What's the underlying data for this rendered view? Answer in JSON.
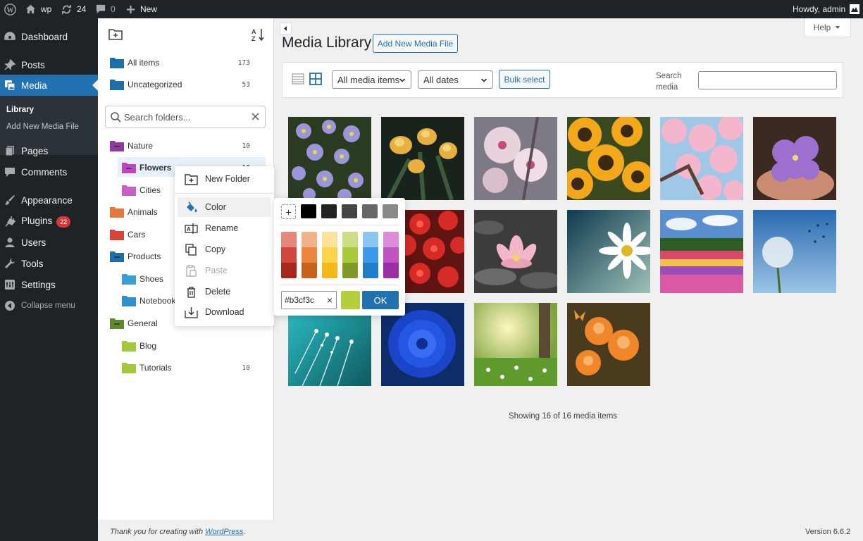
{
  "admin_bar": {
    "site_name": "wp",
    "updates_count": "24",
    "comments_count": "0",
    "new_label": "New",
    "greeting": "Howdy, admin"
  },
  "sidebar": {
    "items": [
      {
        "label": "Dashboard",
        "icon": "dashboard-icon"
      },
      {
        "label": "Posts",
        "icon": "pushpin-icon"
      },
      {
        "label": "Media",
        "icon": "media-icon"
      },
      {
        "label": "Pages",
        "icon": "page-icon"
      },
      {
        "label": "Comments",
        "icon": "comment-icon"
      },
      {
        "label": "Appearance",
        "icon": "paintbrush-icon"
      },
      {
        "label": "Plugins",
        "icon": "plugin-icon",
        "badge": "22"
      },
      {
        "label": "Users",
        "icon": "user-icon"
      },
      {
        "label": "Tools",
        "icon": "wrench-icon"
      },
      {
        "label": "Settings",
        "icon": "settings-icon"
      }
    ],
    "submenu": [
      {
        "label": "Library"
      },
      {
        "label": "Add New Media File"
      }
    ],
    "collapse_label": "Collapse menu"
  },
  "folder_panel": {
    "search_placeholder": "Search folders...",
    "special": [
      {
        "label": "All items",
        "count": "173"
      },
      {
        "label": "Uncategorized",
        "count": "53"
      }
    ],
    "folders": [
      {
        "label": "Nature",
        "count": "10",
        "color": "#8f3b9c"
      },
      {
        "label": "Flowers",
        "count": "10",
        "color": "#c043c0"
      },
      {
        "label": "Cities",
        "count": "",
        "color": "#c85fc8"
      },
      {
        "label": "Animals",
        "count": "",
        "color": "#e07a3f"
      },
      {
        "label": "Cars",
        "count": "",
        "color": "#d6453b"
      },
      {
        "label": "Products",
        "count": "",
        "color": "#1e6fa6"
      },
      {
        "label": "Shoes",
        "count": "",
        "color": "#3a9fd8"
      },
      {
        "label": "Notebooks",
        "count": "",
        "color": "#2f8fd1"
      },
      {
        "label": "General",
        "count": "",
        "color": "#5f8a2c"
      },
      {
        "label": "Blog",
        "count": "",
        "color": "#a3c93b"
      },
      {
        "label": "Tutorials",
        "count": "10",
        "color": "#a3c93b"
      }
    ]
  },
  "context_menu": {
    "items": [
      {
        "label": "New Folder",
        "icon": "new-folder-icon"
      },
      {
        "label": "Color",
        "icon": "paint-bucket-icon"
      },
      {
        "label": "Rename",
        "icon": "rename-icon"
      },
      {
        "label": "Copy",
        "icon": "copy-icon"
      },
      {
        "label": "Paste",
        "icon": "paste-icon"
      },
      {
        "label": "Delete",
        "icon": "trash-icon"
      },
      {
        "label": "Download",
        "icon": "download-icon"
      }
    ]
  },
  "color_picker": {
    "add_label": "+",
    "grays": [
      "#000000",
      "#222222",
      "#444444",
      "#666666",
      "#888888"
    ],
    "palettes": [
      [
        "#e5877e",
        "#d2483e",
        "#a5271f"
      ],
      [
        "#f0b288",
        "#ea8641",
        "#c8611a"
      ],
      [
        "#fbe39a",
        "#fcd44c",
        "#f3b916"
      ],
      [
        "#c9de85",
        "#a9c93b",
        "#7f9a25"
      ],
      [
        "#8bc7f1",
        "#3d9ae6",
        "#1f7ec7"
      ],
      [
        "#dc8cd8",
        "#c053c0",
        "#9b2ca4"
      ]
    ],
    "hex_value": "#b3cf3c",
    "clear_label": "×",
    "preview_color": "#b3cf3c",
    "ok_label": "OK"
  },
  "main": {
    "help_label": "Help",
    "title": "Media Library",
    "add_new_label": "Add New Media File",
    "filter_type": "All media items",
    "filter_date": "All dates",
    "bulk_select_label": "Bulk select",
    "search_label": "Search media",
    "search_value": "",
    "status_text": "Showing 16 of 16 media items"
  },
  "footer": {
    "thanks_text": "Thank you for creating with ",
    "wp_link": "WordPress",
    "thanks_end": ".",
    "version": "Version 6.6.2"
  },
  "colors": {
    "sidebar_bg": "#1d2327",
    "accent": "#2271b1",
    "admin_bg": "#f0f0f1"
  }
}
